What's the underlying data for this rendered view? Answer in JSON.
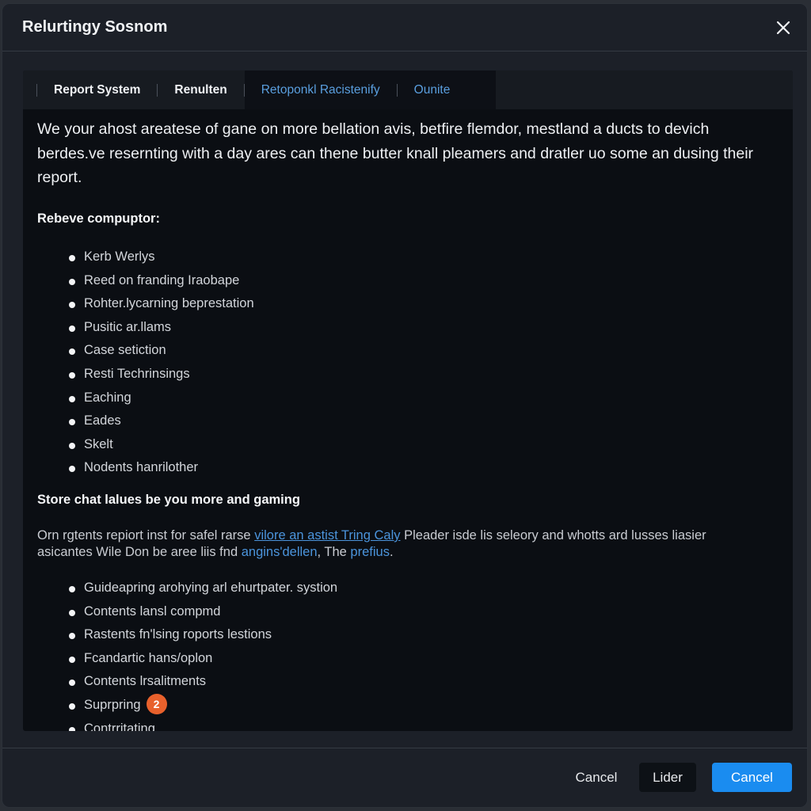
{
  "dialog": {
    "title": "Relurtingy Sosnom",
    "close_icon": "close-icon"
  },
  "tabs": [
    {
      "label": "Report System",
      "active": false
    },
    {
      "label": "Renulten",
      "active": false
    },
    {
      "label": "Retoponkl Racistenify",
      "active": true
    },
    {
      "label": "Ounite",
      "active": false
    }
  ],
  "content": {
    "intro": "We your ahost areatese of gane on more bellation avis, betfire flemdor, mestland a ducts to devich berdes.ve resernting with a day ares can thene butter knall pleamers and dratler uo some an dusing their report.",
    "section1": {
      "title": "Rebeve compuptor:",
      "items": [
        "Kerb Werlys",
        "Reed on franding Iraobape",
        "Rohter.lycarning beprestation",
        "Pusitic ar.llams",
        "Case setiction",
        "Resti Techrinsings",
        "Eaching",
        "Eades",
        "Skelt",
        "Nodents hanrilother"
      ]
    },
    "section2": {
      "title": "Store chat lalues be you  more and gaming",
      "paragraph": {
        "part1": "Orn rgtents repiort inst for safel rarse ",
        "link1": "vilore an astist Tring Caly",
        "part2": " Pleader isde lis seleory and whotts ard lusses liasier asicantes Wile Don be aree liis fnd ",
        "link2": "angins'dellen",
        "part3": ", The ",
        "link3": "prefius",
        "part4": "."
      },
      "items": [
        {
          "label": "Guideapring arohying arl ehurtpater. systion"
        },
        {
          "label": "Contents lansl compmd"
        },
        {
          "label": "Rastents fn'lsing roports lestions"
        },
        {
          "label": "Fcandartic hans/oplon"
        },
        {
          "label": "Contents lrsalitments"
        },
        {
          "label": "Suprpring",
          "badge": "2",
          "badge_color": "#e8612c"
        },
        {
          "label": "Contrritating"
        }
      ]
    }
  },
  "footer": {
    "cancel_text_label": "Cancel",
    "secondary_label": "Lider",
    "primary_label": "Cancel",
    "primary_color": "#1a8cf0"
  }
}
